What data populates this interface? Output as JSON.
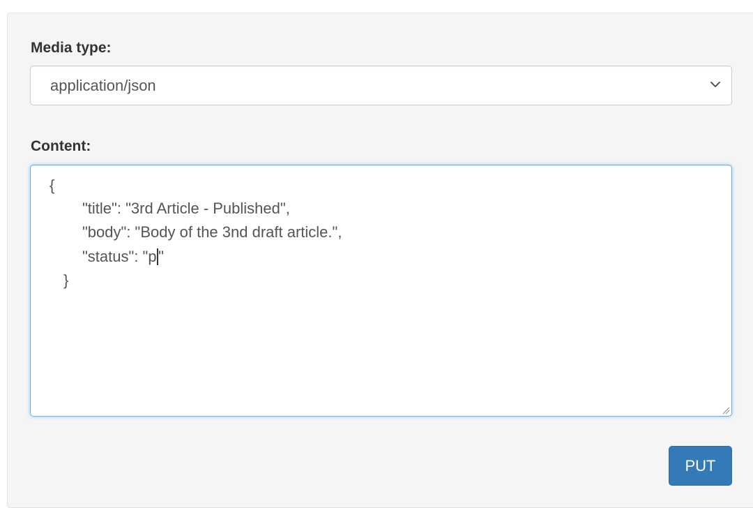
{
  "form": {
    "media_type_label": "Media type:",
    "media_type_value": "application/json",
    "content_label": "Content:",
    "content_lines": {
      "open_brace": "{",
      "title_line": "\"title\": \"3rd Article - Published\",",
      "body_line": "\"body\": \"Body of the 3nd draft article.\",",
      "status_before_caret": "\"status\": \"p",
      "status_after_caret": "\"",
      "close_brace": "}"
    },
    "submit_label": "PUT"
  },
  "icons": {
    "select_arrow": "chevron-down-icon",
    "resize": "resize-handle-icon"
  },
  "colors": {
    "button": "#337ab7",
    "focus_border": "#66afe9",
    "panel_bg": "#f5f5f5",
    "text": "#555555",
    "label": "#333333"
  }
}
